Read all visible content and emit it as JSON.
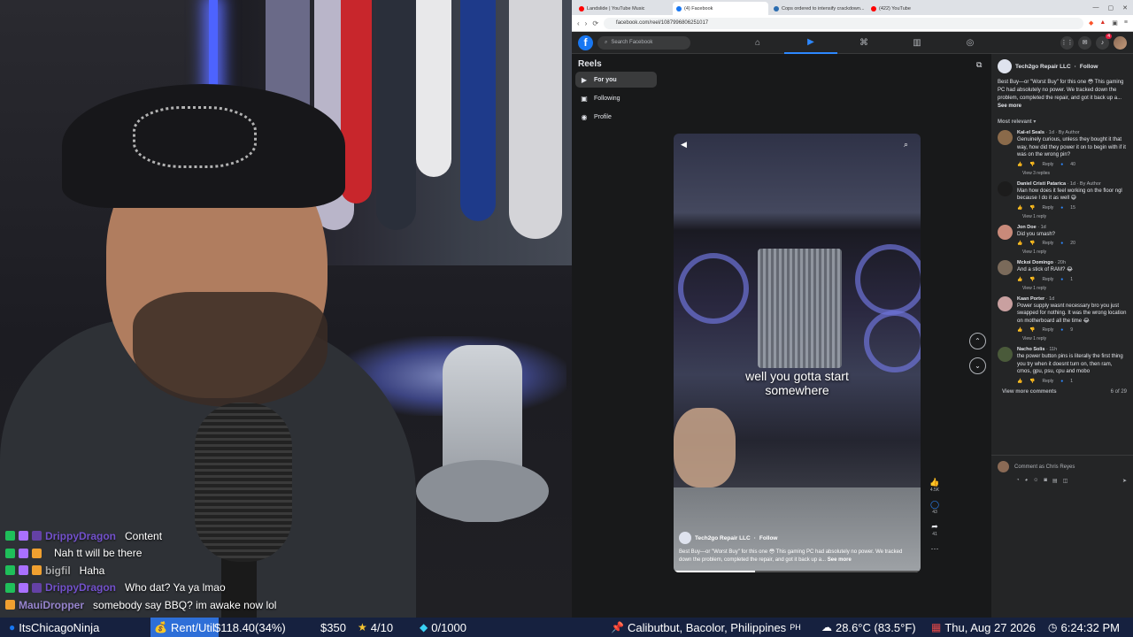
{
  "browser": {
    "tabs": [
      {
        "label": "Landslide | YouTube Music",
        "color": "#ff0000",
        "active": false
      },
      {
        "label": "(4) Facebook",
        "color": "#1877f2",
        "active": true
      },
      {
        "label": "Cops ordered to intensify crackdown...",
        "color": "#2b6cb0",
        "active": false
      },
      {
        "label": "(422) YouTube",
        "color": "#ff0000",
        "active": false
      }
    ],
    "url": "facebook.com/reel/1087996806251017"
  },
  "fb": {
    "search_placeholder": "Search Facebook",
    "notif_count": "4"
  },
  "reels_sidebar": {
    "title": "Reels",
    "items": [
      {
        "label": "For you",
        "icon": "play-icon",
        "active": true
      },
      {
        "label": "Following",
        "icon": "following-icon",
        "active": false
      },
      {
        "label": "Profile",
        "icon": "profile-icon",
        "active": false
      }
    ]
  },
  "reel": {
    "caption_line1": "well you gotta start",
    "caption_line2": "somewhere",
    "author": "Tech2go Repair LLC",
    "follow": "Follow",
    "description": "Best Buy—or \"Worst Buy\" for this one 😳 This gaming PC had absolutely no power. We tracked down the problem, completed the repair, and got it back up a...",
    "see_more": "See more",
    "likes": "4.5K",
    "comments": "43",
    "shares": "41",
    "progress": 0.33
  },
  "comments_panel": {
    "author": "Tech2go Repair LLC",
    "follow": "Follow",
    "description": "Best Buy—or \"Worst Buy\" for this one 😳 This gaming PC had absolutely no power. We tracked down the problem, completed the repair, and got it back up a...",
    "see_more": "See more",
    "sort": "Most relevant",
    "items": [
      {
        "name": "Kal-el Seals",
        "meta": "· 1d · By Author",
        "text": "Genuinely curious, unless they bought it that way, how did they power it on to begin with if it was on the wrong pin?",
        "count": "40",
        "replies": "View 3 replies",
        "color": "#8a6a4a"
      },
      {
        "name": "Daniel Cristi Patarica",
        "meta": "· 1d · By Author",
        "text": "Man how does it feel working on the floor ngl because I do it as well 😅",
        "count": "15",
        "replies": "View 1 reply",
        "color": "#1c1c1c"
      },
      {
        "name": "Jon Doe",
        "meta": "· 1d",
        "text": "Did you smash?",
        "count": "20",
        "replies": "View 1 reply",
        "color": "#c98a7a"
      },
      {
        "name": "Mckoi Domingo",
        "meta": "· 20h",
        "text": "And a stick of RAM? 😂",
        "count": "1",
        "replies": "View 1 reply",
        "color": "#7a6a5a"
      },
      {
        "name": "Kaan Porter",
        "meta": "· 1d",
        "text": "Power supply wasnt necessary bro you just swapped for nothing. It was the wrong location on motherboard all the time 😂",
        "count": "9",
        "replies": "View 1 reply",
        "color": "#c9a0a0"
      },
      {
        "name": "Nacho Solis",
        "meta": "· 11h",
        "text": "the power button pins is literally the first thing you try when it doesnt turn on, then ram, cmos, gpu, psu, cpu and mobo",
        "count": "1",
        "replies": "",
        "color": "#4a5a3a"
      }
    ],
    "view_more": "View more comments",
    "page": "6 of 29",
    "comment_as": "Comment as Chris Reyes"
  },
  "chat": [
    {
      "user": "DrippyDragon",
      "msg": "Content",
      "color": "#8a5cff"
    },
    {
      "user": "",
      "msg": "Nah tt will be there",
      "color": "#ffffff"
    },
    {
      "user": "bigfil",
      "msg": "Haha",
      "color": "#cfcfcf"
    },
    {
      "user": "DrippyDragon",
      "msg": "Who dat? Ya ya lmao",
      "color": "#8a5cff"
    },
    {
      "user": "MauiDropper",
      "msg": "somebody say BBQ? im awake now lol",
      "color": "#b9a0ff"
    }
  ],
  "ticker": {
    "channel": "ItsChicagoNinja",
    "rent_label": "Rent/Util",
    "rent_value": "$118.40(34%)",
    "money": "$350",
    "stars": "4/10",
    "gems": "0/1000",
    "location": "Calibutbut, Bacolor, Philippines",
    "country": "PH",
    "weather": "28.6°C (83.5°F)",
    "date": "Thu, Aug 27 2026",
    "time": "6:24:32 PM"
  }
}
